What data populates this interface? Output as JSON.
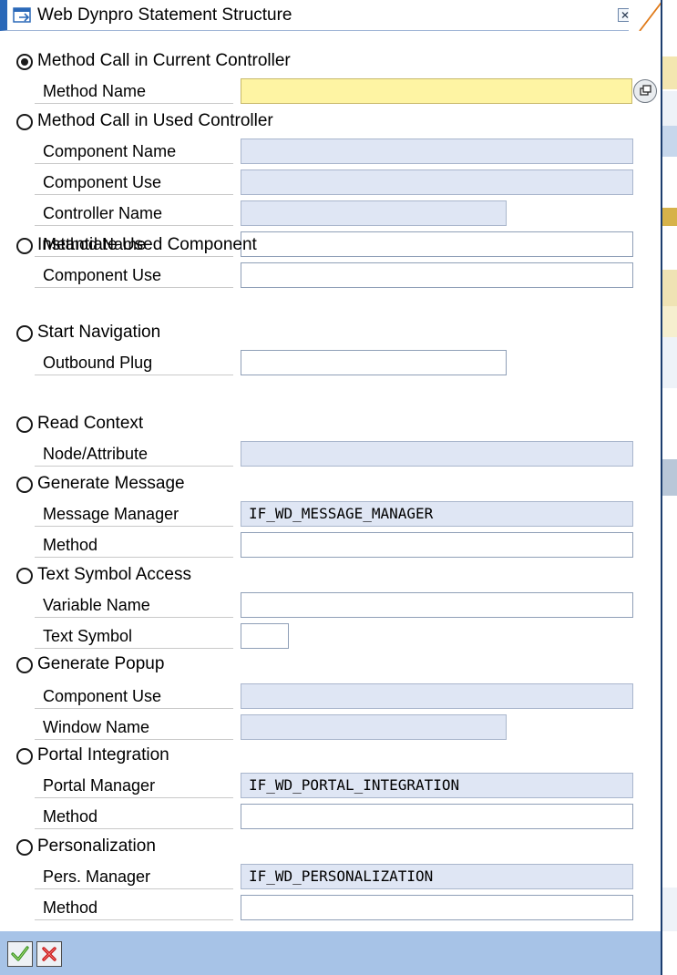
{
  "dialog": {
    "title": "Web Dynpro Statement Structure"
  },
  "options": [
    {
      "id": "method-call-current",
      "label": "Method Call in Current Controller",
      "checked": true,
      "fields": [
        {
          "label": "Method Name",
          "value": "",
          "state": "required"
        }
      ]
    },
    {
      "id": "method-call-used",
      "label": "Method Call in Used Controller",
      "checked": false,
      "fields": [
        {
          "label": "Component Name",
          "value": "",
          "state": "readonly"
        },
        {
          "label": "Component Use",
          "value": "",
          "state": "readonly"
        },
        {
          "label": "Controller Name",
          "value": "",
          "state": "readonly"
        },
        {
          "label": "Method Name",
          "value": "",
          "state": "editable"
        }
      ]
    },
    {
      "id": "instantiate-component",
      "label": "Instantiate Used Component",
      "checked": false,
      "fields": [
        {
          "label": "Component Use",
          "value": "",
          "state": "editable"
        }
      ]
    },
    {
      "id": "start-navigation",
      "label": "Start Navigation",
      "checked": false,
      "fields": [
        {
          "label": "Outbound Plug",
          "value": "",
          "state": "editable"
        }
      ]
    },
    {
      "id": "read-context",
      "label": "Read Context",
      "checked": false,
      "fields": [
        {
          "label": "Node/Attribute",
          "value": "",
          "state": "readonly"
        }
      ]
    },
    {
      "id": "generate-message",
      "label": "Generate Message",
      "checked": false,
      "fields": [
        {
          "label": "Message Manager",
          "value": "IF_WD_MESSAGE_MANAGER",
          "state": "readonly"
        },
        {
          "label": "Method",
          "value": "",
          "state": "editable"
        }
      ]
    },
    {
      "id": "text-symbol-access",
      "label": "Text Symbol Access",
      "checked": false,
      "fields": [
        {
          "label": "Variable Name",
          "value": "",
          "state": "editable"
        },
        {
          "label": "Text Symbol",
          "value": "",
          "state": "editable"
        }
      ]
    },
    {
      "id": "generate-popup",
      "label": "Generate Popup",
      "checked": false,
      "fields": [
        {
          "label": "Component Use",
          "value": "",
          "state": "readonly"
        },
        {
          "label": "Window Name",
          "value": "",
          "state": "readonly"
        }
      ]
    },
    {
      "id": "portal-integration",
      "label": "Portal Integration",
      "checked": false,
      "fields": [
        {
          "label": "Portal Manager",
          "value": "IF_WD_PORTAL_INTEGRATION",
          "state": "readonly"
        },
        {
          "label": "Method",
          "value": "",
          "state": "editable"
        }
      ]
    },
    {
      "id": "personalization",
      "label": "Personalization",
      "checked": false,
      "fields": [
        {
          "label": "Pers. Manager",
          "value": "IF_WD_PERSONALIZATION",
          "state": "readonly"
        },
        {
          "label": "Method",
          "value": "",
          "state": "editable"
        }
      ]
    }
  ],
  "footer": {
    "buttons": [
      {
        "name": "confirm-button",
        "icon": "checkmark-icon",
        "color": "#2f8f1d"
      },
      {
        "name": "cancel-button",
        "icon": "cross-icon",
        "color": "#c81414"
      }
    ]
  },
  "colors": {
    "required_field": "#fef4a3",
    "readonly_field": "#dfe6f4",
    "footer_bar": "#a7c3e7",
    "title_accent": "#2a68b8"
  }
}
